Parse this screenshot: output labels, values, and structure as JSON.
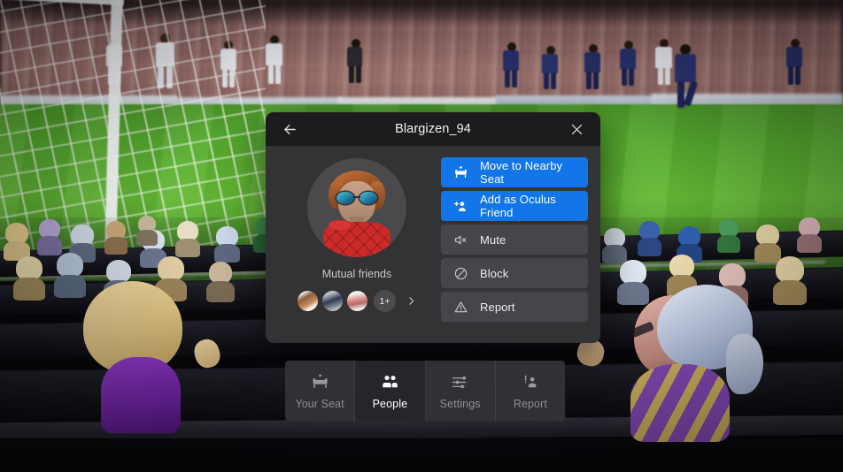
{
  "scene": {
    "description": "VR stadium viewing experience — soccer match on pitch with stylized avatar audience",
    "sport": "soccer",
    "team_home_color": "#f2f4f7",
    "team_away_color": "#27306b"
  },
  "panel": {
    "title": "Blargizen_94",
    "back_icon": "arrow-left-icon",
    "close_icon": "close-icon",
    "profile": {
      "avatar_alt": "user-avatar",
      "mutual_friends_label": "Mutual friends",
      "mutual_friends": [
        {
          "name": "mutual-friend-1"
        },
        {
          "name": "mutual-friend-2"
        },
        {
          "name": "mutual-friend-3"
        }
      ],
      "more_count_label": "1+",
      "chevron_icon": "chevron-right-icon"
    },
    "actions": [
      {
        "label": "Move to Nearby Seat",
        "icon": "seat-icon",
        "style": "primary"
      },
      {
        "label": "Add as Oculus Friend",
        "icon": "add-person-icon",
        "style": "primary"
      },
      {
        "label": "Mute",
        "icon": "speaker-mute-icon",
        "style": "secondary"
      },
      {
        "label": "Block",
        "icon": "circle-slash-icon",
        "style": "secondary"
      },
      {
        "label": "Report",
        "icon": "warning-triangle-icon",
        "style": "secondary"
      }
    ]
  },
  "bottom_nav": {
    "tabs": [
      {
        "label": "Your Seat",
        "icon": "seat-icon",
        "active": false
      },
      {
        "label": "People",
        "icon": "people-icon",
        "active": true
      },
      {
        "label": "Settings",
        "icon": "sliders-icon",
        "active": false
      },
      {
        "label": "Report",
        "icon": "report-person-icon",
        "active": false
      }
    ]
  },
  "colors": {
    "primary_blue": "#1275e8",
    "panel_bg": "#333335",
    "titlebar_bg": "#1c1c1e",
    "secondary_btn": "#46464a",
    "text_primary": "#ffffff",
    "text_muted": "#8e8e93"
  }
}
